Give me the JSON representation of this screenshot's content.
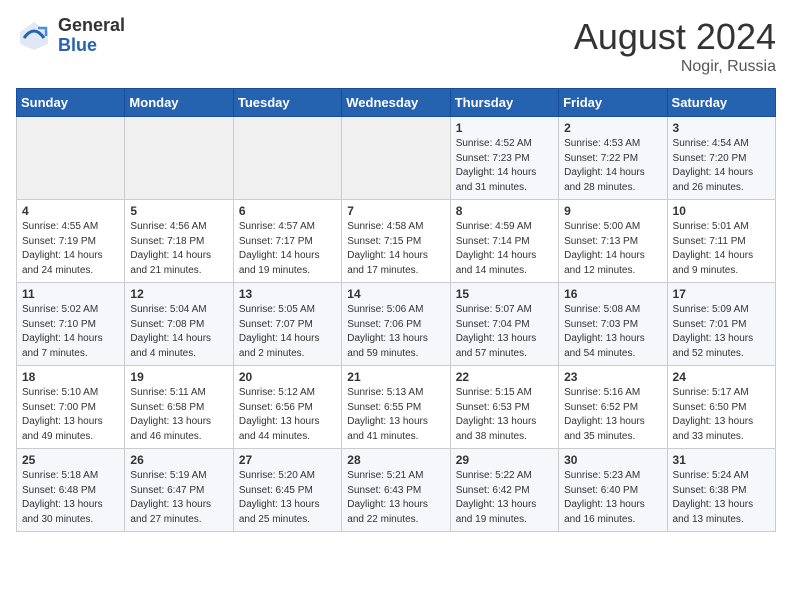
{
  "header": {
    "logo_general": "General",
    "logo_blue": "Blue",
    "month_year": "August 2024",
    "location": "Nogir, Russia"
  },
  "days_of_week": [
    "Sunday",
    "Monday",
    "Tuesday",
    "Wednesday",
    "Thursday",
    "Friday",
    "Saturday"
  ],
  "weeks": [
    [
      {
        "day": "",
        "info": ""
      },
      {
        "day": "",
        "info": ""
      },
      {
        "day": "",
        "info": ""
      },
      {
        "day": "",
        "info": ""
      },
      {
        "day": "1",
        "info": "Sunrise: 4:52 AM\nSunset: 7:23 PM\nDaylight: 14 hours\nand 31 minutes."
      },
      {
        "day": "2",
        "info": "Sunrise: 4:53 AM\nSunset: 7:22 PM\nDaylight: 14 hours\nand 28 minutes."
      },
      {
        "day": "3",
        "info": "Sunrise: 4:54 AM\nSunset: 7:20 PM\nDaylight: 14 hours\nand 26 minutes."
      }
    ],
    [
      {
        "day": "4",
        "info": "Sunrise: 4:55 AM\nSunset: 7:19 PM\nDaylight: 14 hours\nand 24 minutes."
      },
      {
        "day": "5",
        "info": "Sunrise: 4:56 AM\nSunset: 7:18 PM\nDaylight: 14 hours\nand 21 minutes."
      },
      {
        "day": "6",
        "info": "Sunrise: 4:57 AM\nSunset: 7:17 PM\nDaylight: 14 hours\nand 19 minutes."
      },
      {
        "day": "7",
        "info": "Sunrise: 4:58 AM\nSunset: 7:15 PM\nDaylight: 14 hours\nand 17 minutes."
      },
      {
        "day": "8",
        "info": "Sunrise: 4:59 AM\nSunset: 7:14 PM\nDaylight: 14 hours\nand 14 minutes."
      },
      {
        "day": "9",
        "info": "Sunrise: 5:00 AM\nSunset: 7:13 PM\nDaylight: 14 hours\nand 12 minutes."
      },
      {
        "day": "10",
        "info": "Sunrise: 5:01 AM\nSunset: 7:11 PM\nDaylight: 14 hours\nand 9 minutes."
      }
    ],
    [
      {
        "day": "11",
        "info": "Sunrise: 5:02 AM\nSunset: 7:10 PM\nDaylight: 14 hours\nand 7 minutes."
      },
      {
        "day": "12",
        "info": "Sunrise: 5:04 AM\nSunset: 7:08 PM\nDaylight: 14 hours\nand 4 minutes."
      },
      {
        "day": "13",
        "info": "Sunrise: 5:05 AM\nSunset: 7:07 PM\nDaylight: 14 hours\nand 2 minutes."
      },
      {
        "day": "14",
        "info": "Sunrise: 5:06 AM\nSunset: 7:06 PM\nDaylight: 13 hours\nand 59 minutes."
      },
      {
        "day": "15",
        "info": "Sunrise: 5:07 AM\nSunset: 7:04 PM\nDaylight: 13 hours\nand 57 minutes."
      },
      {
        "day": "16",
        "info": "Sunrise: 5:08 AM\nSunset: 7:03 PM\nDaylight: 13 hours\nand 54 minutes."
      },
      {
        "day": "17",
        "info": "Sunrise: 5:09 AM\nSunset: 7:01 PM\nDaylight: 13 hours\nand 52 minutes."
      }
    ],
    [
      {
        "day": "18",
        "info": "Sunrise: 5:10 AM\nSunset: 7:00 PM\nDaylight: 13 hours\nand 49 minutes."
      },
      {
        "day": "19",
        "info": "Sunrise: 5:11 AM\nSunset: 6:58 PM\nDaylight: 13 hours\nand 46 minutes."
      },
      {
        "day": "20",
        "info": "Sunrise: 5:12 AM\nSunset: 6:56 PM\nDaylight: 13 hours\nand 44 minutes."
      },
      {
        "day": "21",
        "info": "Sunrise: 5:13 AM\nSunset: 6:55 PM\nDaylight: 13 hours\nand 41 minutes."
      },
      {
        "day": "22",
        "info": "Sunrise: 5:15 AM\nSunset: 6:53 PM\nDaylight: 13 hours\nand 38 minutes."
      },
      {
        "day": "23",
        "info": "Sunrise: 5:16 AM\nSunset: 6:52 PM\nDaylight: 13 hours\nand 35 minutes."
      },
      {
        "day": "24",
        "info": "Sunrise: 5:17 AM\nSunset: 6:50 PM\nDaylight: 13 hours\nand 33 minutes."
      }
    ],
    [
      {
        "day": "25",
        "info": "Sunrise: 5:18 AM\nSunset: 6:48 PM\nDaylight: 13 hours\nand 30 minutes."
      },
      {
        "day": "26",
        "info": "Sunrise: 5:19 AM\nSunset: 6:47 PM\nDaylight: 13 hours\nand 27 minutes."
      },
      {
        "day": "27",
        "info": "Sunrise: 5:20 AM\nSunset: 6:45 PM\nDaylight: 13 hours\nand 25 minutes."
      },
      {
        "day": "28",
        "info": "Sunrise: 5:21 AM\nSunset: 6:43 PM\nDaylight: 13 hours\nand 22 minutes."
      },
      {
        "day": "29",
        "info": "Sunrise: 5:22 AM\nSunset: 6:42 PM\nDaylight: 13 hours\nand 19 minutes."
      },
      {
        "day": "30",
        "info": "Sunrise: 5:23 AM\nSunset: 6:40 PM\nDaylight: 13 hours\nand 16 minutes."
      },
      {
        "day": "31",
        "info": "Sunrise: 5:24 AM\nSunset: 6:38 PM\nDaylight: 13 hours\nand 13 minutes."
      }
    ]
  ]
}
